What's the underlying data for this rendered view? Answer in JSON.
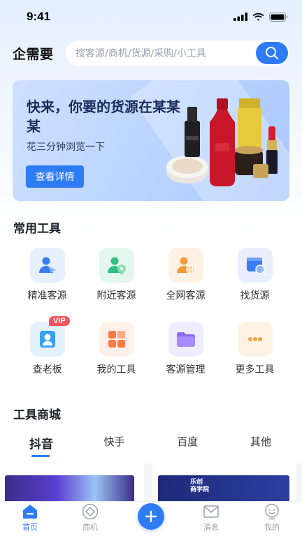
{
  "status_bar": {
    "time": "9:41"
  },
  "header": {
    "title": "企需要",
    "search_placeholder": "搜客源/商机/货源/采购/小工具"
  },
  "banner": {
    "title": "快来，你要的货源在某某某",
    "subtitle": "花三分钟浏览一下",
    "button_label": "查看详情"
  },
  "tools_section": {
    "title": "常用工具",
    "items": [
      {
        "label": "精准客源",
        "icon": "target-customer-icon",
        "bg": "#e7f0ff"
      },
      {
        "label": "附近客源",
        "icon": "nearby-customer-icon",
        "bg": "#e4f7ee"
      },
      {
        "label": "全网客源",
        "icon": "global-customer-icon",
        "bg": "#fff1e3"
      },
      {
        "label": "找货源",
        "icon": "find-supply-icon",
        "bg": "#e9efff"
      },
      {
        "label": "查老板",
        "icon": "boss-lookup-icon",
        "bg": "#e4f2ff",
        "badge": "VIP"
      },
      {
        "label": "我的工具",
        "icon": "my-tools-icon",
        "bg": "#fff0ea"
      },
      {
        "label": "客源管理",
        "icon": "folder-icon",
        "bg": "#f0ecff"
      },
      {
        "label": "更多工具",
        "icon": "more-dots-icon",
        "bg": "#fff3e6"
      }
    ]
  },
  "shop_section": {
    "title": "工具商城",
    "tabs": [
      "抖音",
      "快手",
      "百度",
      "其他"
    ],
    "active_tab": 0,
    "card2_texts": [
      "乐创",
      "商学院"
    ]
  },
  "bottom_nav": {
    "items": [
      {
        "label": "首页",
        "icon": "home-icon",
        "active": true
      },
      {
        "label": "商机",
        "icon": "opportunity-icon",
        "active": false
      },
      {
        "label": "消息",
        "icon": "message-icon",
        "active": false
      },
      {
        "label": "我的",
        "icon": "profile-icon",
        "active": false
      }
    ],
    "add_icon": "plus-icon"
  },
  "colors": {
    "accent": "#2e7bf6",
    "vip": "#f0545a"
  }
}
